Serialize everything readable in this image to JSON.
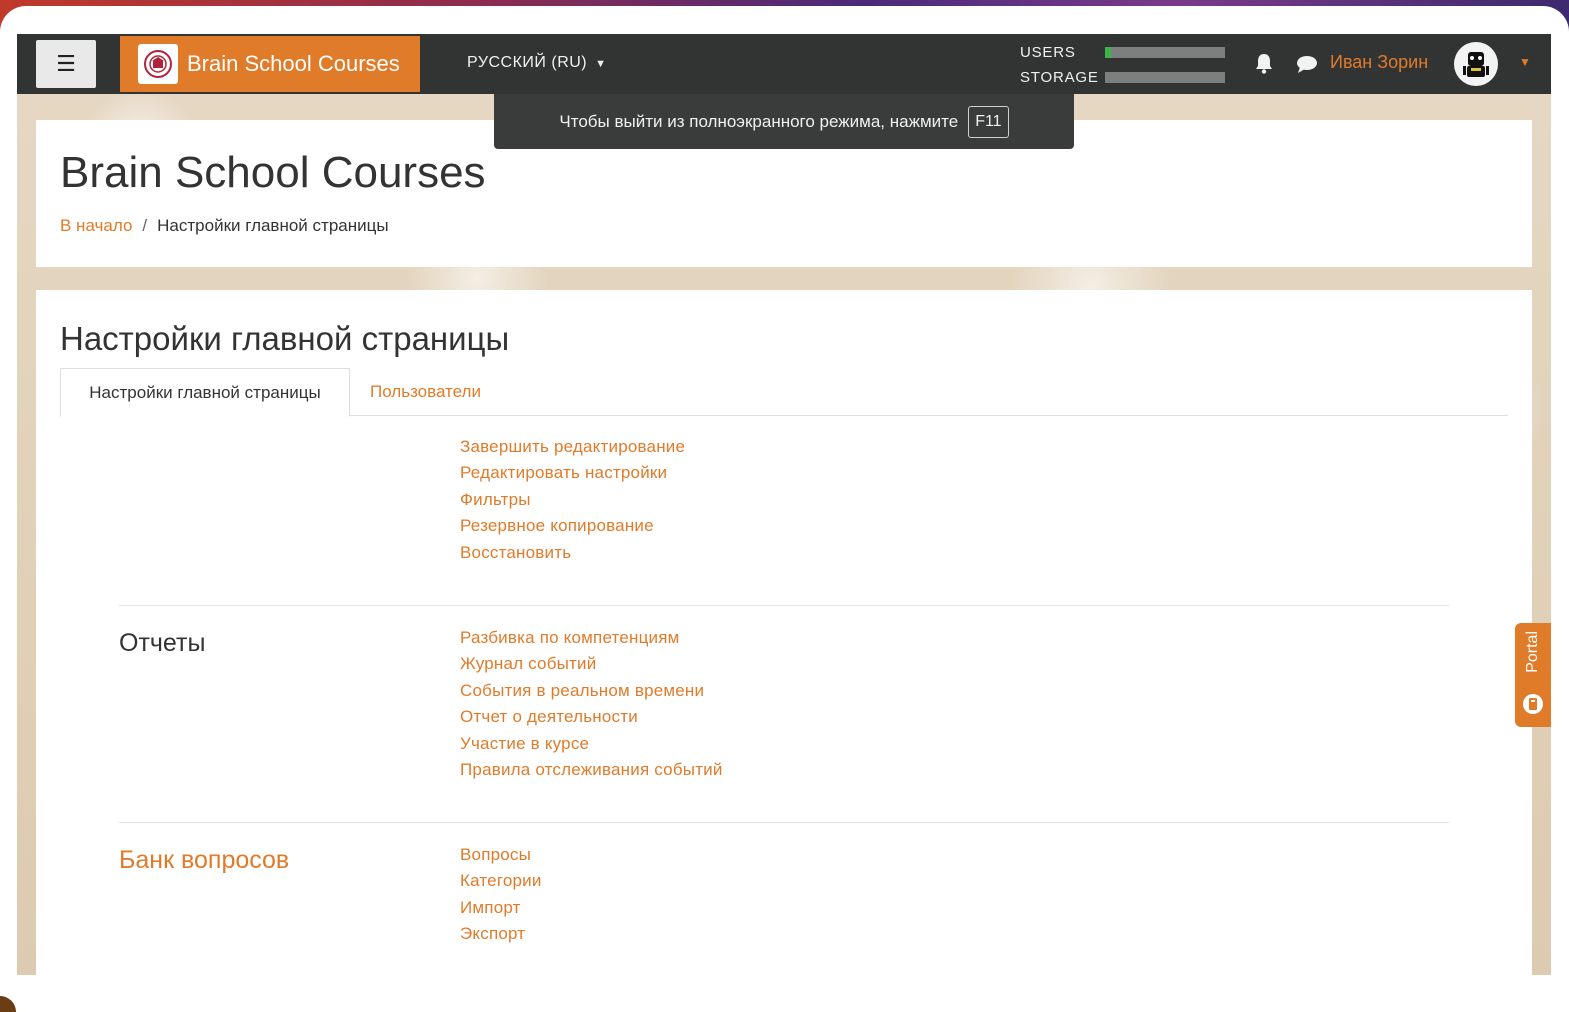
{
  "navbar": {
    "menu_icon": "hamburger-icon",
    "brand": "Brain School Courses",
    "language": "РУССКИЙ (RU)",
    "quota": [
      {
        "label": "USERS",
        "fill": 0.05
      },
      {
        "label": "STORAGE",
        "fill": 0.0
      }
    ],
    "username": "Иван Зорин",
    "icons": [
      "bell-icon",
      "chat-icon",
      "avatar",
      "caret-down-icon"
    ]
  },
  "fullscreen_tip": {
    "text": "Чтобы выйти из полноэкранного режима, нажмите",
    "key": "F11"
  },
  "header": {
    "title": "Brain School Courses",
    "breadcrumb": {
      "home": "В начало",
      "separator": "/",
      "current": "Настройки главной страницы"
    }
  },
  "main": {
    "heading": "Настройки главной страницы",
    "tabs": [
      {
        "label": "Настройки главной страницы",
        "active": true
      },
      {
        "label": "Пользователи",
        "active": false
      }
    ],
    "sections": [
      {
        "title": "",
        "links": [
          "Завершить редактирование",
          "Редактировать настройки",
          "Фильтры",
          "Резервное копирование",
          "Восстановить"
        ]
      },
      {
        "title": "Отчеты",
        "links": [
          "Разбивка по компетенциям",
          "Журнал событий",
          "События в реальном времени",
          "Отчет о деятельности",
          "Участие в курсе",
          "Правила отслеживания событий"
        ]
      },
      {
        "title": "Банк вопросов",
        "links": [
          "Вопросы",
          "Категории",
          "Импорт",
          "Экспорт"
        ]
      }
    ]
  },
  "portal_tab": {
    "label": "Portal"
  },
  "colors": {
    "accent": "#e07b2a",
    "navbar": "#323434",
    "text": "#333333"
  }
}
